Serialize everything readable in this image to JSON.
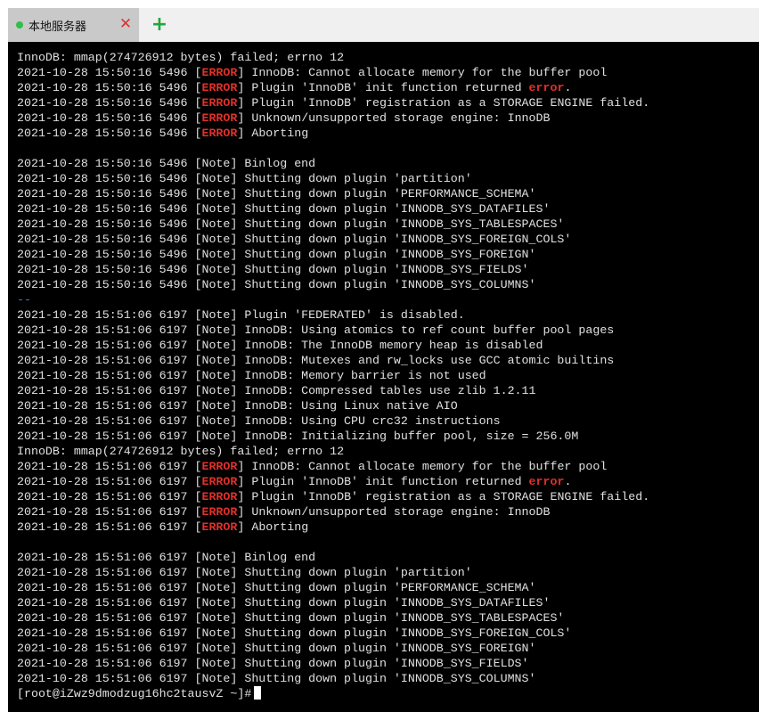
{
  "tabbar": {
    "tabs": [
      {
        "label": "本地服务器",
        "status_color": "#2fbf4a"
      }
    ],
    "close_icon": "close-icon",
    "add_icon": "add-tab-icon"
  },
  "terminal": {
    "lines": [
      [
        [
          "",
          "InnoDB: mmap(274726912 bytes) failed; errno 12"
        ]
      ],
      [
        [
          "",
          "2021-10-28 15:50:16 5496 ["
        ],
        [
          "err",
          "ERROR"
        ],
        [
          "",
          "] InnoDB: Cannot allocate memory for the buffer pool"
        ]
      ],
      [
        [
          "",
          "2021-10-28 15:50:16 5496 ["
        ],
        [
          "err",
          "ERROR"
        ],
        [
          "",
          "] Plugin 'InnoDB' init function returned "
        ],
        [
          "err",
          "error"
        ],
        [
          "",
          "."
        ]
      ],
      [
        [
          "",
          "2021-10-28 15:50:16 5496 ["
        ],
        [
          "err",
          "ERROR"
        ],
        [
          "",
          "] Plugin 'InnoDB' registration as a STORAGE ENGINE failed."
        ]
      ],
      [
        [
          "",
          "2021-10-28 15:50:16 5496 ["
        ],
        [
          "err",
          "ERROR"
        ],
        [
          "",
          "] Unknown/unsupported storage engine: InnoDB"
        ]
      ],
      [
        [
          "",
          "2021-10-28 15:50:16 5496 ["
        ],
        [
          "err",
          "ERROR"
        ],
        [
          "",
          "] Aborting"
        ]
      ],
      [
        [
          "",
          ""
        ]
      ],
      [
        [
          "",
          "2021-10-28 15:50:16 5496 [Note] Binlog end"
        ]
      ],
      [
        [
          "",
          "2021-10-28 15:50:16 5496 [Note] Shutting down plugin 'partition'"
        ]
      ],
      [
        [
          "",
          "2021-10-28 15:50:16 5496 [Note] Shutting down plugin 'PERFORMANCE_SCHEMA'"
        ]
      ],
      [
        [
          "",
          "2021-10-28 15:50:16 5496 [Note] Shutting down plugin 'INNODB_SYS_DATAFILES'"
        ]
      ],
      [
        [
          "",
          "2021-10-28 15:50:16 5496 [Note] Shutting down plugin 'INNODB_SYS_TABLESPACES'"
        ]
      ],
      [
        [
          "",
          "2021-10-28 15:50:16 5496 [Note] Shutting down plugin 'INNODB_SYS_FOREIGN_COLS'"
        ]
      ],
      [
        [
          "",
          "2021-10-28 15:50:16 5496 [Note] Shutting down plugin 'INNODB_SYS_FOREIGN'"
        ]
      ],
      [
        [
          "",
          "2021-10-28 15:50:16 5496 [Note] Shutting down plugin 'INNODB_SYS_FIELDS'"
        ]
      ],
      [
        [
          "",
          "2021-10-28 15:50:16 5496 [Note] Shutting down plugin 'INNODB_SYS_COLUMNS'"
        ]
      ],
      [
        [
          "sep",
          "--"
        ]
      ],
      [
        [
          "",
          "2021-10-28 15:51:06 6197 [Note] Plugin 'FEDERATED' is disabled."
        ]
      ],
      [
        [
          "",
          "2021-10-28 15:51:06 6197 [Note] InnoDB: Using atomics to ref count buffer pool pages"
        ]
      ],
      [
        [
          "",
          "2021-10-28 15:51:06 6197 [Note] InnoDB: The InnoDB memory heap is disabled"
        ]
      ],
      [
        [
          "",
          "2021-10-28 15:51:06 6197 [Note] InnoDB: Mutexes and rw_locks use GCC atomic builtins"
        ]
      ],
      [
        [
          "",
          "2021-10-28 15:51:06 6197 [Note] InnoDB: Memory barrier is not used"
        ]
      ],
      [
        [
          "",
          "2021-10-28 15:51:06 6197 [Note] InnoDB: Compressed tables use zlib 1.2.11"
        ]
      ],
      [
        [
          "",
          "2021-10-28 15:51:06 6197 [Note] InnoDB: Using Linux native AIO"
        ]
      ],
      [
        [
          "",
          "2021-10-28 15:51:06 6197 [Note] InnoDB: Using CPU crc32 instructions"
        ]
      ],
      [
        [
          "",
          "2021-10-28 15:51:06 6197 [Note] InnoDB: Initializing buffer pool, size = 256.0M"
        ]
      ],
      [
        [
          "",
          "InnoDB: mmap(274726912 bytes) failed; errno 12"
        ]
      ],
      [
        [
          "",
          "2021-10-28 15:51:06 6197 ["
        ],
        [
          "err",
          "ERROR"
        ],
        [
          "",
          "] InnoDB: Cannot allocate memory for the buffer pool"
        ]
      ],
      [
        [
          "",
          "2021-10-28 15:51:06 6197 ["
        ],
        [
          "err",
          "ERROR"
        ],
        [
          "",
          "] Plugin 'InnoDB' init function returned "
        ],
        [
          "err",
          "error"
        ],
        [
          "",
          "."
        ]
      ],
      [
        [
          "",
          "2021-10-28 15:51:06 6197 ["
        ],
        [
          "err",
          "ERROR"
        ],
        [
          "",
          "] Plugin 'InnoDB' registration as a STORAGE ENGINE failed."
        ]
      ],
      [
        [
          "",
          "2021-10-28 15:51:06 6197 ["
        ],
        [
          "err",
          "ERROR"
        ],
        [
          "",
          "] Unknown/unsupported storage engine: InnoDB"
        ]
      ],
      [
        [
          "",
          "2021-10-28 15:51:06 6197 ["
        ],
        [
          "err",
          "ERROR"
        ],
        [
          "",
          "] Aborting"
        ]
      ],
      [
        [
          "",
          ""
        ]
      ],
      [
        [
          "",
          "2021-10-28 15:51:06 6197 [Note] Binlog end"
        ]
      ],
      [
        [
          "",
          "2021-10-28 15:51:06 6197 [Note] Shutting down plugin 'partition'"
        ]
      ],
      [
        [
          "",
          "2021-10-28 15:51:06 6197 [Note] Shutting down plugin 'PERFORMANCE_SCHEMA'"
        ]
      ],
      [
        [
          "",
          "2021-10-28 15:51:06 6197 [Note] Shutting down plugin 'INNODB_SYS_DATAFILES'"
        ]
      ],
      [
        [
          "",
          "2021-10-28 15:51:06 6197 [Note] Shutting down plugin 'INNODB_SYS_TABLESPACES'"
        ]
      ],
      [
        [
          "",
          "2021-10-28 15:51:06 6197 [Note] Shutting down plugin 'INNODB_SYS_FOREIGN_COLS'"
        ]
      ],
      [
        [
          "",
          "2021-10-28 15:51:06 6197 [Note] Shutting down plugin 'INNODB_SYS_FOREIGN'"
        ]
      ],
      [
        [
          "",
          "2021-10-28 15:51:06 6197 [Note] Shutting down plugin 'INNODB_SYS_FIELDS'"
        ]
      ],
      [
        [
          "",
          "2021-10-28 15:51:06 6197 [Note] Shutting down plugin 'INNODB_SYS_COLUMNS'"
        ]
      ]
    ],
    "prompt": "[root@iZwz9dmodzug16hc2tausvZ ~]#",
    "colors": {
      "background": "#000000",
      "text": "#e0e0e0",
      "error": "#e0302a",
      "separator": "#3a7fd0"
    }
  }
}
